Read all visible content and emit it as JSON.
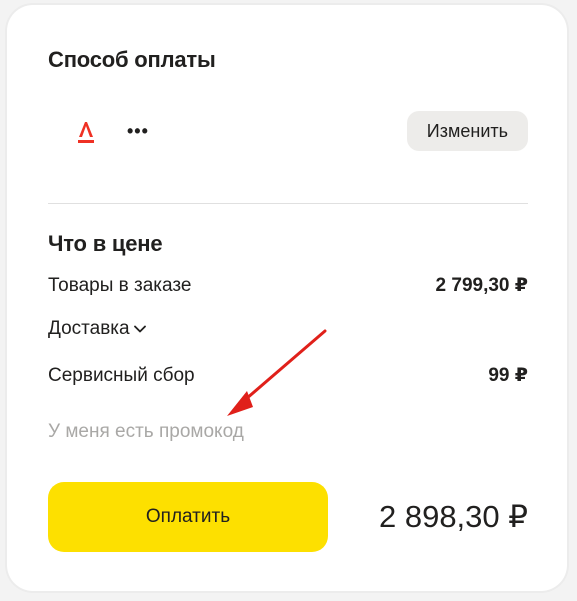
{
  "payment": {
    "title": "Способ оплаты",
    "bank_icon": "alfa-bank-logo",
    "card_mask": "•••",
    "change_label": "Изменить"
  },
  "price": {
    "title": "Что в цене",
    "items_label": "Товары в заказе",
    "items_value": "2 799,30 ₽",
    "delivery_label": "Доставка",
    "service_label": "Сервисный сбор",
    "service_value": "99 ₽",
    "promo_label": "У меня есть промокод"
  },
  "checkout": {
    "pay_label": "Оплатить",
    "total": "2 898,30 ₽"
  },
  "colors": {
    "accent_yellow": "#fde000",
    "alfa_red": "#ef3124",
    "annotation_arrow": "#e0201a"
  }
}
